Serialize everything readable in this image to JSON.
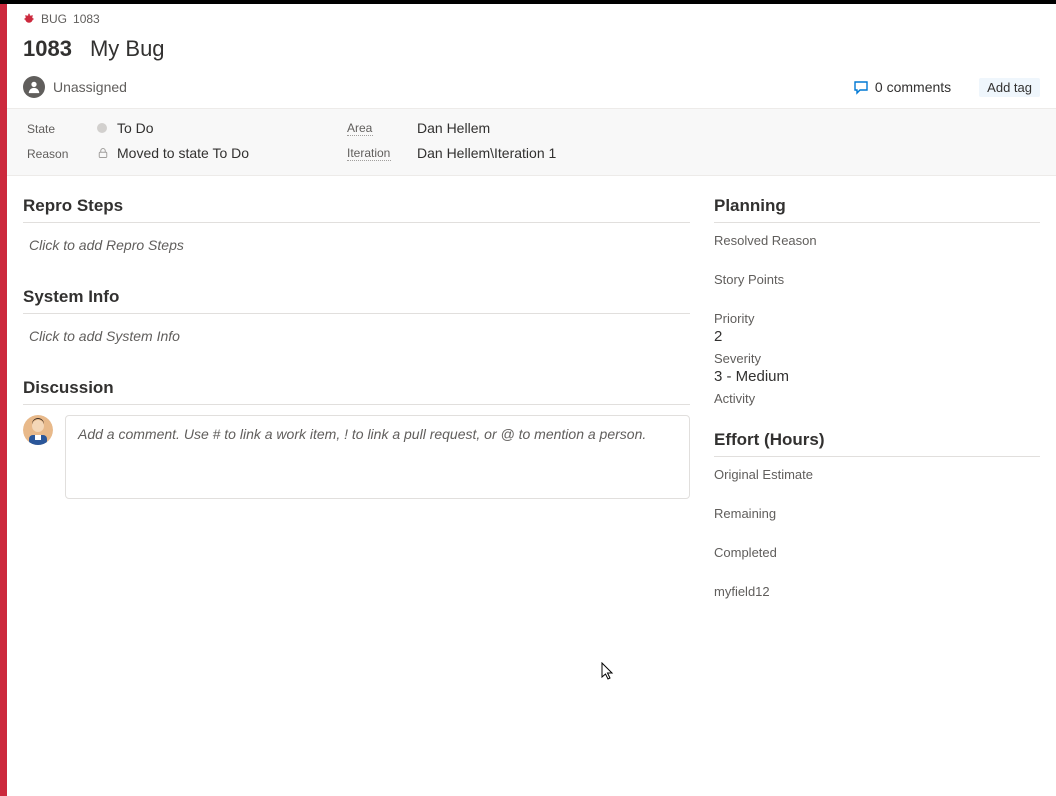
{
  "accent_color": "#cc293d",
  "crumb": {
    "type_label": "BUG",
    "id": "1083"
  },
  "work_item": {
    "id": "1083",
    "title": "My Bug"
  },
  "assignee": {
    "label": "Unassigned"
  },
  "comments": {
    "count_label": "0 comments"
  },
  "add_tag_label": "Add tag",
  "classification": {
    "state_label": "State",
    "state_value": "To Do",
    "reason_label": "Reason",
    "reason_value": "Moved to state To Do",
    "area_label": "Area",
    "area_value": "Dan Hellem",
    "iteration_label": "Iteration",
    "iteration_value": "Dan Hellem\\Iteration 1"
  },
  "sections": {
    "repro_title": "Repro Steps",
    "repro_placeholder": "Click to add Repro Steps",
    "system_info_title": "System Info",
    "system_info_placeholder": "Click to add System Info",
    "discussion_title": "Discussion",
    "discussion_placeholder": "Add a comment. Use # to link a work item, ! to link a pull request, or @ to mention a person."
  },
  "planning": {
    "title": "Planning",
    "resolved_reason_label": "Resolved Reason",
    "resolved_reason_value": "",
    "story_points_label": "Story Points",
    "story_points_value": "",
    "priority_label": "Priority",
    "priority_value": "2",
    "severity_label": "Severity",
    "severity_value": "3 - Medium",
    "activity_label": "Activity",
    "activity_value": ""
  },
  "effort": {
    "title": "Effort (Hours)",
    "original_estimate_label": "Original Estimate",
    "original_estimate_value": "",
    "remaining_label": "Remaining",
    "remaining_value": "",
    "completed_label": "Completed",
    "completed_value": "",
    "custom_field_label": "myfield12",
    "custom_field_value": ""
  }
}
